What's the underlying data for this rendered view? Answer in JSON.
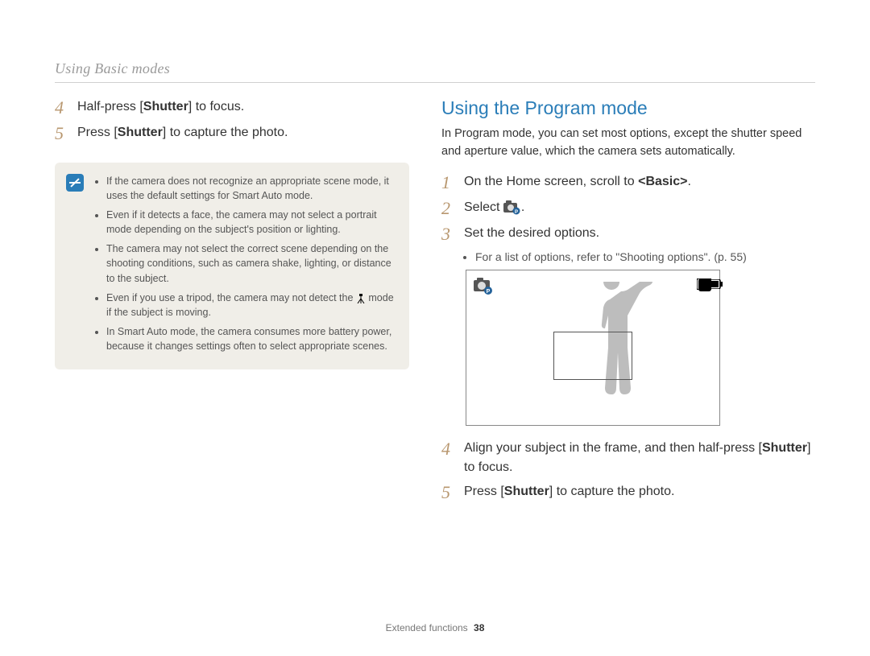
{
  "breadcrumb": "Using Basic modes",
  "left": {
    "steps": [
      {
        "num": "4",
        "html": "Half-press [<b>Shutter</b>] to focus."
      },
      {
        "num": "5",
        "html": "Press [<b>Shutter</b>] to capture the photo."
      }
    ],
    "notes": [
      "If the camera does not recognize an appropriate scene mode, it uses the default settings for Smart Auto mode.",
      "Even if it detects a face, the camera may not select a portrait mode depending on the subject's position or lighting.",
      "The camera may not select the correct scene depending on the shooting conditions, such as camera shake, lighting, or distance to the subject.",
      "Even if you use a tripod, the camera may not detect the {TRIPOD} mode if the subject is moving.",
      "In Smart Auto mode, the camera consumes more battery power, because it changes settings often to select appropriate scenes."
    ]
  },
  "right": {
    "heading": "Using the Program mode",
    "intro": "In Program mode, you can set most options, except the shutter speed and aperture value, which the camera sets automatically.",
    "steps_a": [
      {
        "num": "1",
        "html": "On the Home screen, scroll to <b>&lt;Basic&gt;</b>."
      },
      {
        "num": "2",
        "html": "Select {PICON}."
      },
      {
        "num": "3",
        "html": "Set the desired options."
      }
    ],
    "sub_bullet": "For a list of options, refer to \"Shooting options\". (p. 55)",
    "steps_b": [
      {
        "num": "4",
        "html": "Align your subject in the frame, and then half-press [<b>Shutter</b>] to focus."
      },
      {
        "num": "5",
        "html": "Press [<b>Shutter</b>] to capture the photo."
      }
    ],
    "overlay_count": "1"
  },
  "footer": {
    "section": "Extended functions",
    "page": "38"
  }
}
